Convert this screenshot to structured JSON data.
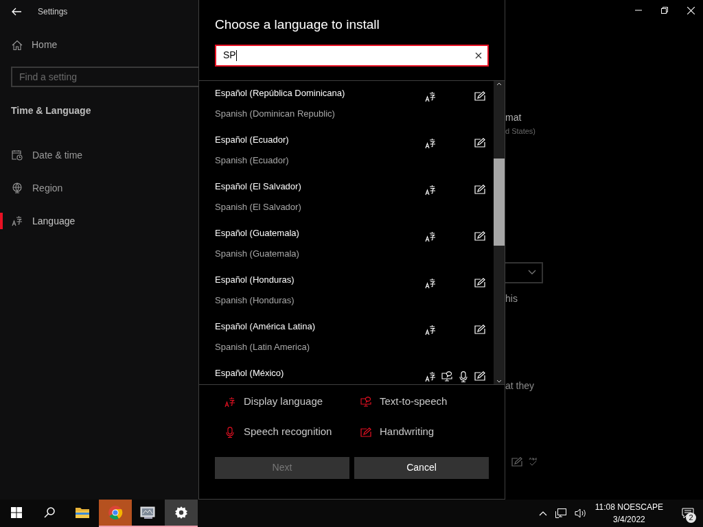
{
  "settings_window": {
    "title": "Settings",
    "home": "Home",
    "search": {
      "placeholder": "Find a setting"
    },
    "section": "Time & Language",
    "nav": [
      {
        "label": "Date & time",
        "kind": "calendar",
        "selected": false
      },
      {
        "label": "Region",
        "kind": "globe",
        "selected": false
      },
      {
        "label": "Language",
        "kind": "language",
        "selected": true
      }
    ],
    "background_texts": [
      "mat",
      "d States)",
      "his",
      "at they"
    ]
  },
  "dialog": {
    "title": "Choose a language to install",
    "search": {
      "value": "SP"
    },
    "languages": [
      {
        "name": "Español (República Dominicana)",
        "english": "Spanish (Dominican Republic)",
        "display": true,
        "tts": false,
        "speech": false,
        "handwriting": true
      },
      {
        "name": "Español (Ecuador)",
        "english": "Spanish (Ecuador)",
        "display": true,
        "tts": false,
        "speech": false,
        "handwriting": true
      },
      {
        "name": "Español (El Salvador)",
        "english": "Spanish (El Salvador)",
        "display": true,
        "tts": false,
        "speech": false,
        "handwriting": true
      },
      {
        "name": "Español (Guatemala)",
        "english": "Spanish (Guatemala)",
        "display": true,
        "tts": false,
        "speech": false,
        "handwriting": true
      },
      {
        "name": "Español (Honduras)",
        "english": "Spanish (Honduras)",
        "display": true,
        "tts": false,
        "speech": false,
        "handwriting": true
      },
      {
        "name": "Español (América Latina)",
        "english": "Spanish (Latin America)",
        "display": true,
        "tts": false,
        "speech": false,
        "handwriting": true
      },
      {
        "name": "Español (México)",
        "display": true,
        "tts": true,
        "speech": true,
        "handwriting": true
      }
    ],
    "legend": [
      {
        "kind": "display",
        "label": "Display language"
      },
      {
        "kind": "tts",
        "label": "Text-to-speech"
      },
      {
        "kind": "speech",
        "label": "Speech recognition"
      },
      {
        "kind": "handwriting",
        "label": "Handwriting"
      }
    ],
    "buttons": [
      {
        "label": "Next",
        "disabled": true
      },
      {
        "label": "Cancel",
        "disabled": false
      }
    ]
  },
  "taskbar": {
    "apps": [
      {
        "kind": "start",
        "active": false,
        "running": false
      },
      {
        "kind": "search",
        "active": false,
        "running": false
      },
      {
        "kind": "folder",
        "active": false,
        "running": false
      },
      {
        "kind": "browser",
        "active": true,
        "running": true
      },
      {
        "kind": "monitor",
        "active": false,
        "running": true
      },
      {
        "kind": "settings",
        "active": false,
        "running": true
      }
    ],
    "time": "11:08 NOESCAPE",
    "date": "3/4/2022",
    "notifications": "2"
  }
}
